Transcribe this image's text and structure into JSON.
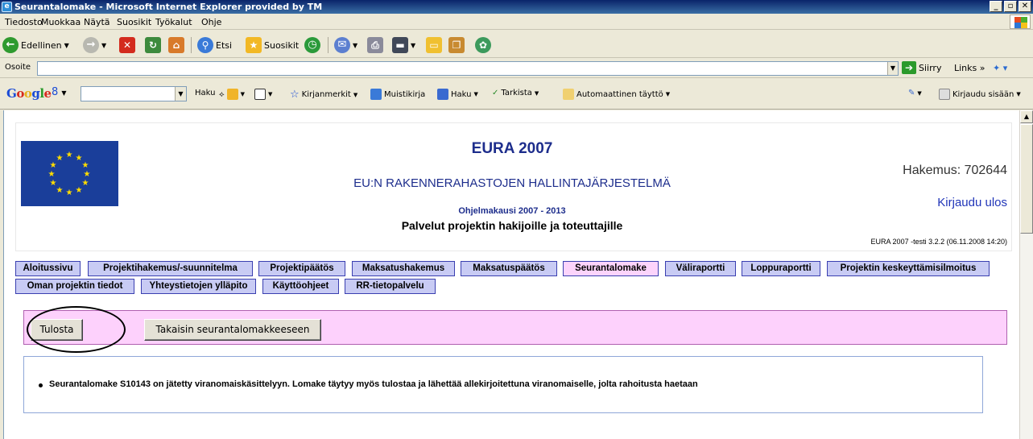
{
  "window": {
    "title": "Seurantalomake - Microsoft Internet Explorer provided by TM"
  },
  "menu": [
    "Tiedosto",
    "Muokkaa",
    "Näytä",
    "Suosikit",
    "Työkalut",
    "Ohje"
  ],
  "toolbar": {
    "back_label": "Edellinen",
    "search_label": "Etsi",
    "favorites_label": "Suosikit"
  },
  "address": {
    "label": "Osoite",
    "value": "",
    "go_label": "Siirry",
    "links_label": "Links"
  },
  "google": {
    "logo": "Google",
    "search_value": "",
    "haku_label": "Haku",
    "bookmarks_label": "Kirjanmerkit",
    "notebook_label": "Muistikirja",
    "haku2_label": "Haku",
    "check_label": "Tarkista",
    "autofill_label": "Automaattinen täyttö",
    "signin_label": "Kirjaudu sisään"
  },
  "header": {
    "title": "EURA 2007",
    "subtitle": "EU:N RAKENNERAHASTOJEN HALLINTAJÄRJESTELMÄ",
    "program_period": "Ohjelmakausi 2007 - 2013",
    "services": "Palvelut projektin hakijoille ja toteuttajille",
    "application": "Hakemus: 702644",
    "logout": "Kirjaudu ulos",
    "version": "EURA 2007 -testi 3.2.2 (06.11.2008 14:20)"
  },
  "nav": [
    "Aloitussivu",
    "Projektihakemus/-suunnitelma",
    "Projektipäätös",
    "Maksatushakemus",
    "Maksatuspäätös",
    "Seurantalomake",
    "Väliraportti",
    "Loppuraportti",
    "Projektin keskeyttämisilmoitus",
    "Oman projektin tiedot",
    "Yhteystietojen ylläpito",
    "Käyttöohjeet",
    "RR-tietopalvelu"
  ],
  "actions": {
    "print_label": "Tulosta",
    "back_label": "Takaisin seurantalomakkeeseen"
  },
  "message": "Seurantalomake S10143 on jätetty viranomaiskäsittelyyn. Lomake täytyy myös tulostaa ja lähettää allekirjoitettuna viranomaiselle, jolta rahoitusta haetaan",
  "colors": {
    "nav_bg": "#c8cbf4",
    "nav_active_bg": "#fcd4fb",
    "action_bar_bg": "#fdd1fc",
    "title_blue": "#1d2d8c",
    "link_blue": "#2035b8"
  }
}
